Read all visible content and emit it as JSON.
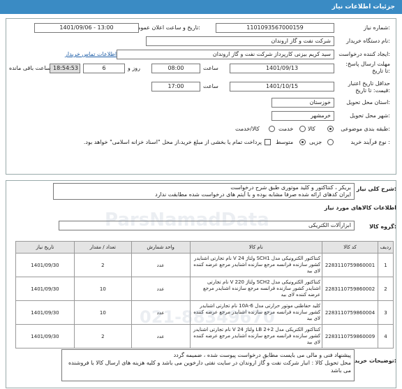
{
  "header": {
    "title": "جزئیات اطلاعات نیاز"
  },
  "form": {
    "need_number": {
      "label": "شماره نیاز:",
      "value": "1101093567000159"
    },
    "announce_datetime": {
      "label": "تاریخ و ساعت اعلان عمومی:",
      "value": "1401/09/06 - 13:00"
    },
    "buyer_org": {
      "label": "نام دستگاه خریدار:",
      "value": "شرکت نفت و گاز اروندان"
    },
    "requester": {
      "label": "ایجاد کننده درخواست:",
      "value": "سید کریم بیزنی کارپرداز شرکت نفت و گاز اروندان",
      "contact_link": "اطلاعات تماس خریدار"
    },
    "deadline": {
      "label": "مهلت ارسال پاسخ: تا تاریخ:",
      "date": "1401/09/13",
      "time_label": "ساعت",
      "time": "08:00",
      "days": "6",
      "days_label": "روز و",
      "remaining": "18:54:53",
      "remaining_label": "ساعت باقی مانده"
    },
    "validity": {
      "label": "حداقل تاریخ اعتبار قیمت: تا تاریخ:",
      "date": "1401/10/15",
      "time_label": "ساعت",
      "time": "17:00"
    },
    "province": {
      "label": "استان محل تحویل:",
      "value": "خوزستان"
    },
    "city": {
      "label": "شهر محل تحویل:",
      "value": "خرمشهر"
    },
    "category": {
      "label": "طبقه بندی موضوعی:",
      "options": [
        "کالا",
        "خدمت",
        "کالا/خدمت"
      ],
      "selected": "کالا"
    },
    "process": {
      "label": "نوع فرآیند خرید :",
      "options": [
        "جزیی",
        "متوسط"
      ],
      "selected": "متوسط",
      "payment_note": "پرداخت تمام یا بخشی از مبلغ خرید،از محل \"اسناد خزانه اسلامی\" خواهد بود."
    }
  },
  "summary": {
    "label": "شرح کلی نیاز:",
    "lines": [
      "بریکر ، کنتاکتور و کلید موتوری طبق شرح درخواست",
      "ایران کدهای ارائه شده صرفا مشابه بوده و با آیتم های درخواست شده مطابقت ندارد"
    ]
  },
  "goods": {
    "title": "اطلاعات کالاهای مورد نیاز",
    "group_label": "گروه کالا:",
    "group_value": "ابزارآلات الکتریکی",
    "columns": [
      "ردیف",
      "کد کالا",
      "نام کالا",
      "واحد شمارش",
      "تعداد / مقدار",
      "تاریخ نیاز"
    ],
    "rows": [
      {
        "idx": "1",
        "code": "2283110759860001",
        "name": "کنتاکتور الکترونیکی مدل SCH1 ولتاژ 24 V نام تجارتی اشنایدر کشور سازنده فرانسه مرجع سازنده اشنایدر مرجع عرضه کننده لای بید",
        "unit": "عدد",
        "qty": "2",
        "date": "1401/09/30"
      },
      {
        "idx": "2",
        "code": "2283110759860002",
        "name": "کنتاکتور الکترونیکی مدل SCH2 ولتاژ 220 V نام تجارتی اشنایدر کشور سازنده فرانسه مرجع سازنده اشنایدر مرجع عرضه کننده لای بید",
        "unit": "عدد",
        "qty": "10",
        "date": "1401/09/30"
      },
      {
        "idx": "3",
        "code": "2283110759860004",
        "name": "کلید حفاظتی موتور حرارتی مدل 6-10A نام تجارتی اشنایدر کشور سازنده فرانسه مرجع سازنده اشنایدر مرجع عرضه کننده لای بید",
        "unit": "عدد",
        "qty": "10",
        "date": "1401/09/30"
      },
      {
        "idx": "4",
        "code": "2283110759860009",
        "name": "کنتاکتور الکتریکی مدل LB 2+2 ولتاژ 24 V نام تجارتی اشنایدر کشور سازنده فرانسه مرجع سازنده اشنایدر مرجع عرضه کننده لای بید",
        "unit": "عدد",
        "qty": "2",
        "date": "1401/09/30"
      }
    ]
  },
  "notes": {
    "label": "توضیحات خریدار:",
    "lines": [
      "پیشنهاد فنی و مالی می بایست مطابق درخواست پیوست شده ، ضمیمه گردد",
      "محل تحویل کالا : انبار شرکت نفت و گاز اروندان در سایت نفتی دارخوین می باشد و کلیه هزینه های ارسال کالا با فروشنده می باشد"
    ]
  },
  "watermark": {
    "brand": "ParsNamadData",
    "phone": "021-88349670"
  }
}
